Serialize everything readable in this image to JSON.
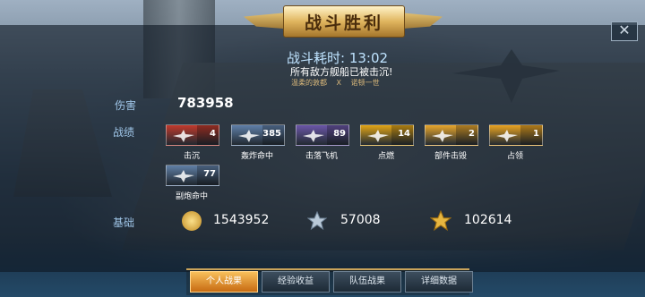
{
  "header": {
    "title": "战斗胜利",
    "close": "✕"
  },
  "battle": {
    "time_label": "战斗耗时: 13:02",
    "sunk_msg": "所有敌方舰船已被击沉!",
    "participants": [
      "温柔的敦都",
      "X",
      "诺顿一世"
    ]
  },
  "stats": {
    "damage_label": "伤害",
    "damage_value": "783958",
    "achievements_label": "战绩",
    "badges": [
      {
        "name": "击沉",
        "count": "4",
        "color": "#c0392b",
        "icon": "plane-icon"
      },
      {
        "name": "轰炸命中",
        "count": "385",
        "color": "#5f7fa8",
        "icon": "bomber-icon"
      },
      {
        "name": "击落飞机",
        "count": "89",
        "color": "#6b56a8",
        "icon": "fighter-icon"
      },
      {
        "name": "点燃",
        "count": "14",
        "color": "#e2a515",
        "icon": "fire-icon"
      },
      {
        "name": "部件击毁",
        "count": "2",
        "color": "#e8a62b",
        "icon": "explosion-icon"
      },
      {
        "name": "占领",
        "count": "1",
        "color": "#e9a320",
        "icon": "chevron-icon"
      },
      {
        "name": "副炮命中",
        "count": "77",
        "color": "#607fa6",
        "icon": "gun-icon"
      }
    ],
    "base_label": "基础",
    "resources": [
      {
        "value": "1543952",
        "icon": "coin-icon",
        "color": "#e8b53c"
      },
      {
        "value": "57008",
        "icon": "star-silver-icon",
        "color": "#b9c9d8"
      },
      {
        "value": "102614",
        "icon": "star-gold-icon",
        "color": "#e7b640"
      }
    ]
  },
  "tabs": [
    "个人战果",
    "经验收益",
    "队伍战果",
    "详细数据"
  ]
}
